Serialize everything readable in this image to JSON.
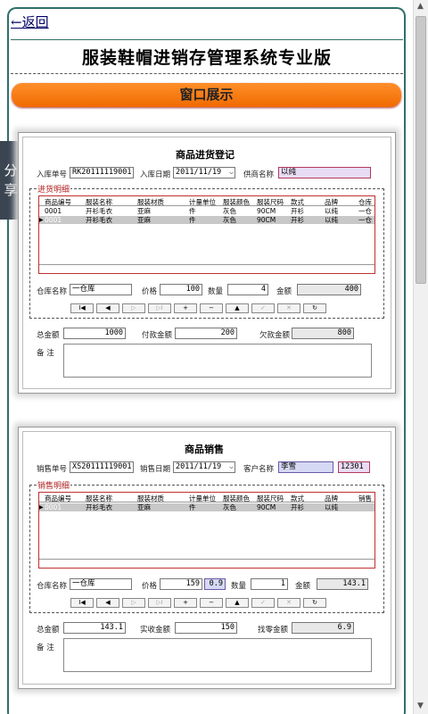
{
  "header": {
    "back_label": "←返回",
    "app_title": "服装鞋帽进销存管理系统专业版",
    "section_bar": "窗口展示"
  },
  "share": {
    "line1": "分",
    "line2": "享"
  },
  "purchase_form": {
    "title": "商品进货登记",
    "order_no_label": "入库单号",
    "order_no": "RK20111119001",
    "date_label": "入库日期",
    "date": "2011/11/19",
    "supplier_label": "供商名称",
    "supplier": "以纯",
    "detail_legend": "进货明细",
    "columns": [
      "商品编号",
      "服装名称",
      "服装材质",
      "计量单位",
      "服装颜色",
      "服装尺码",
      "款式",
      "品牌",
      "仓库"
    ],
    "rows": [
      [
        "0001",
        "开衫毛衣",
        "亚麻",
        "件",
        "灰色",
        "90CM",
        "开衫",
        "以纯",
        "一仓"
      ],
      [
        "0001",
        "开衫毛衣",
        "亚麻",
        "件",
        "灰色",
        "90CM",
        "开衫",
        "以纯",
        "一仓"
      ]
    ],
    "warehouse_label": "仓库名称",
    "warehouse": "一仓库",
    "price_label": "价格",
    "price": "100",
    "qty_label": "数量",
    "qty": "4",
    "amount_label": "金额",
    "amount": "400",
    "total_label": "总金额",
    "total": "1000",
    "paid_label": "付款金额",
    "paid": "200",
    "owed_label": "欠款金额",
    "owed": "800",
    "memo_label": "备  注"
  },
  "sales_form": {
    "title": "商品销售",
    "order_no_label": "销售单号",
    "order_no": "XS20111119001",
    "date_label": "销售日期",
    "date": "2011/11/19",
    "customer_label": "客户名称",
    "customer": "李雪",
    "customer_code": "12301",
    "detail_legend": "销售明细",
    "columns": [
      "商品编号",
      "服装名称",
      "服装材质",
      "计量单位",
      "服装颜色",
      "服装尺码",
      "款式",
      "品牌",
      "销售"
    ],
    "rows": [
      [
        "0001",
        "开衫毛衣",
        "亚麻",
        "件",
        "灰色",
        "90CM",
        "开衫",
        "以纯",
        ""
      ]
    ],
    "warehouse_label": "仓库名称",
    "warehouse": "一仓库",
    "price_label": "价格",
    "price": "159",
    "discount": "0.9",
    "qty_label": "数量",
    "qty": "1",
    "amount_label": "金额",
    "amount": "143.1",
    "total_label": "总金额",
    "total": "143.1",
    "received_label": "实收金额",
    "received": "150",
    "change_label": "找零金额",
    "change": "6.9",
    "memo_label": "备  注"
  },
  "nav_buttons": [
    "I◀",
    "◀",
    "▷",
    "▷I",
    "+",
    "−",
    "▲",
    "✓",
    "✕",
    "↻"
  ]
}
